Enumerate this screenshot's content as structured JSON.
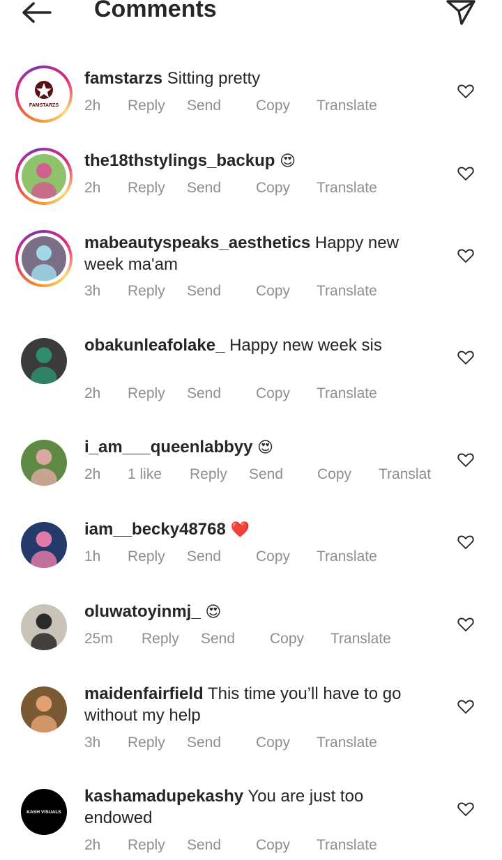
{
  "header": {
    "title": "Comments"
  },
  "comments": [
    {
      "username": "famstarzs",
      "text": "Sitting pretty",
      "emoji": "",
      "time": "2h",
      "likes": "",
      "actions": {
        "reply": "Reply",
        "send": "Send",
        "copy": "Copy",
        "translate": "Translate"
      },
      "avatar": {
        "ring": true,
        "label": "FAMSTARZS",
        "bg": "#ffffff",
        "accent": "#5a1010"
      }
    },
    {
      "username": "the18thstylings_backup",
      "text": "",
      "emoji": "😍",
      "time": "2h",
      "likes": "",
      "actions": {
        "reply": "Reply",
        "send": "Send",
        "copy": "Copy",
        "translate": "Translate"
      },
      "avatar": {
        "ring": true,
        "label": "",
        "bg": "#8fc36b",
        "accent": "#d35f8e"
      }
    },
    {
      "username": "mabeautyspeaks_aesthetics",
      "text": "Happy new week ma'am",
      "emoji": "",
      "time": "3h",
      "likes": "",
      "actions": {
        "reply": "Reply",
        "send": "Send",
        "copy": "Copy",
        "translate": "Translate"
      },
      "avatar": {
        "ring": true,
        "label": "",
        "bg": "#7a6f86",
        "accent": "#9fd8e8"
      }
    },
    {
      "username": "obakunleafolake_",
      "text": "Happy new week sis",
      "emoji": "",
      "time": "2h",
      "likes": "",
      "actions": {
        "reply": "Reply",
        "send": "Send",
        "copy": "Copy",
        "translate": "Translate"
      },
      "avatar": {
        "ring": false,
        "label": "",
        "bg": "#3b3b3b",
        "accent": "#2d8d6e"
      }
    },
    {
      "username": "i_am___queenlabbyy",
      "text": "",
      "emoji": "😍",
      "time": "2h",
      "likes": "1 like",
      "actions": {
        "reply": "Reply",
        "send": "Send",
        "copy": "Copy",
        "translate": "Translat"
      },
      "avatar": {
        "ring": false,
        "label": "",
        "bg": "#5f8a45",
        "accent": "#d9a8a0"
      }
    },
    {
      "username": "iam__becky48768",
      "text": "",
      "emoji": "❤️",
      "time": "1h",
      "likes": "",
      "actions": {
        "reply": "Reply",
        "send": "Send",
        "copy": "Copy",
        "translate": "Translate"
      },
      "avatar": {
        "ring": false,
        "label": "",
        "bg": "#233a6b",
        "accent": "#e07aa8"
      }
    },
    {
      "username": "oluwatoyinmj_",
      "text": "",
      "emoji": "😍",
      "time": "25m",
      "likes": "",
      "actions": {
        "reply": "Reply",
        "send": "Send",
        "copy": "Copy",
        "translate": "Translate"
      },
      "avatar": {
        "ring": false,
        "label": "",
        "bg": "#c9c3b8",
        "accent": "#2a2a2a"
      }
    },
    {
      "username": "maidenfairfield",
      "text": "This time you’ll have to go without my help",
      "emoji": "",
      "time": "3h",
      "likes": "",
      "actions": {
        "reply": "Reply",
        "send": "Send",
        "copy": "Copy",
        "translate": "Translate"
      },
      "avatar": {
        "ring": false,
        "label": "",
        "bg": "#7a5a35",
        "accent": "#e0a070"
      }
    },
    {
      "username": "kashamadupekashy",
      "text": "You are just too endowed",
      "emoji": "",
      "time": "2h",
      "likes": "",
      "actions": {
        "reply": "Reply",
        "send": "Send",
        "copy": "Copy",
        "translate": "Translate"
      },
      "avatar": {
        "ring": false,
        "label": "KASH VISUALS",
        "bg": "#000000",
        "accent": "#ffffff"
      }
    }
  ]
}
